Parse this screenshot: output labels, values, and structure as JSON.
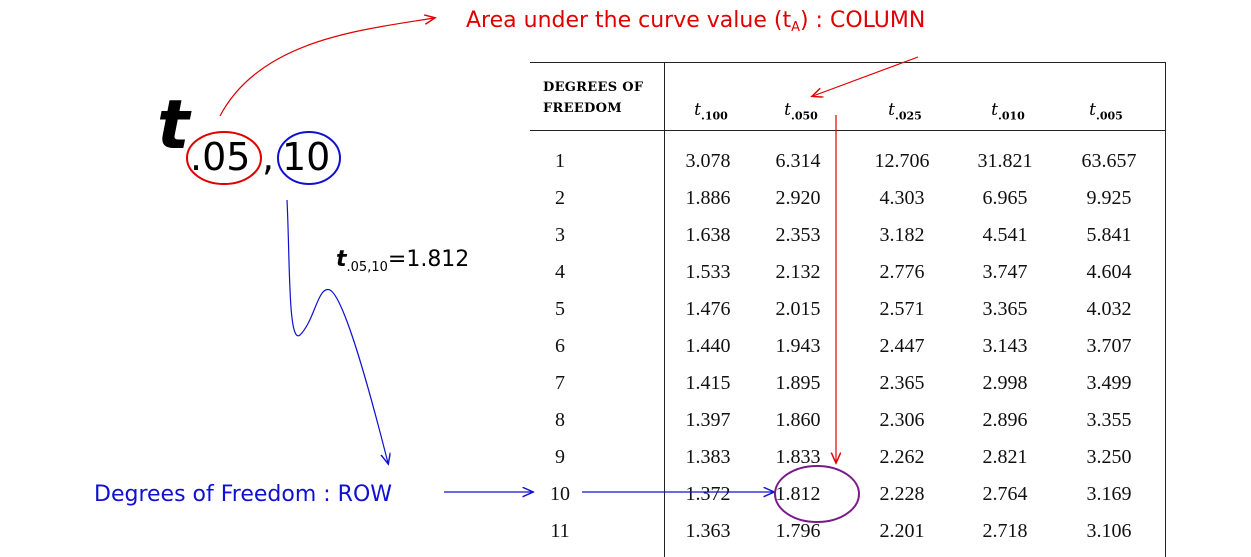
{
  "annotations": {
    "area_note_prefix": "Area under the curve value (t",
    "area_note_sub": "A",
    "area_note_suffix": ") : COLUMN",
    "df_note": "Degrees of Freedom : ROW"
  },
  "notation": {
    "symbol": "t",
    "alpha": ".05",
    "comma": ",",
    "df": "10"
  },
  "result": {
    "symbol": "t",
    "subscript": ".05,10",
    "value": "=1.812"
  },
  "table": {
    "df_header_line1": "DEGREES OF",
    "df_header_line2": "FREEDOM",
    "columns": [
      {
        "symbol": "t",
        "sub": ".100"
      },
      {
        "symbol": "t",
        "sub": ".050"
      },
      {
        "symbol": "t",
        "sub": ".025"
      },
      {
        "symbol": "t",
        "sub": ".010"
      },
      {
        "symbol": "t",
        "sub": ".005"
      }
    ],
    "rows": [
      {
        "df": "1",
        "values": [
          "3.078",
          "6.314",
          "12.706",
          "31.821",
          "63.657"
        ]
      },
      {
        "df": "2",
        "values": [
          "1.886",
          "2.920",
          "4.303",
          "6.965",
          "9.925"
        ]
      },
      {
        "df": "3",
        "values": [
          "1.638",
          "2.353",
          "3.182",
          "4.541",
          "5.841"
        ]
      },
      {
        "df": "4",
        "values": [
          "1.533",
          "2.132",
          "2.776",
          "3.747",
          "4.604"
        ]
      },
      {
        "df": "5",
        "values": [
          "1.476",
          "2.015",
          "2.571",
          "3.365",
          "4.032"
        ]
      },
      {
        "df": "6",
        "values": [
          "1.440",
          "1.943",
          "2.447",
          "3.143",
          "3.707"
        ]
      },
      {
        "df": "7",
        "values": [
          "1.415",
          "1.895",
          "2.365",
          "2.998",
          "3.499"
        ]
      },
      {
        "df": "8",
        "values": [
          "1.397",
          "1.860",
          "2.306",
          "2.896",
          "3.355"
        ]
      },
      {
        "df": "9",
        "values": [
          "1.383",
          "1.833",
          "2.262",
          "2.821",
          "3.250"
        ]
      },
      {
        "df": "10",
        "values": [
          "1.372",
          "1.812",
          "2.228",
          "2.764",
          "3.169"
        ]
      },
      {
        "df": "11",
        "values": [
          "1.363",
          "1.796",
          "2.201",
          "2.718",
          "3.106"
        ]
      }
    ]
  },
  "colors": {
    "alpha_marker": "#e00000",
    "df_marker": "#1010d0",
    "answer_circle": "#7a1a8a",
    "text": "#111111"
  }
}
